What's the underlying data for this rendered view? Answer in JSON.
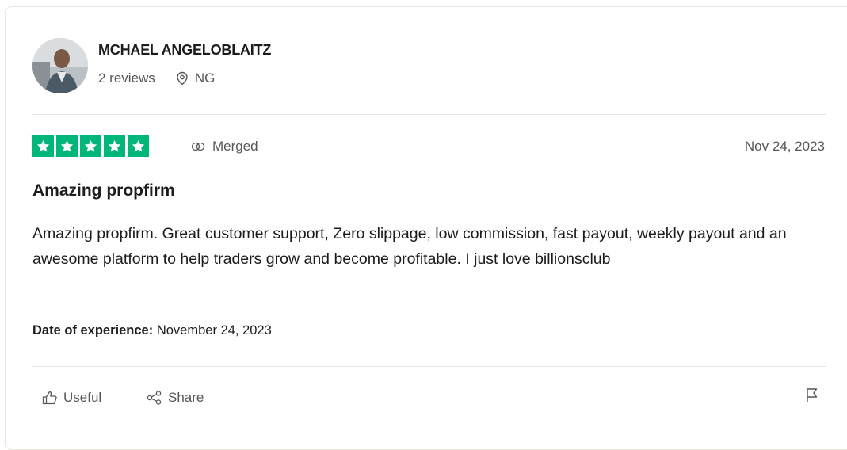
{
  "reviewer": {
    "name": "MCHAEL ANGELOBLAITZ",
    "reviews_count": "2 reviews",
    "country": "NG"
  },
  "review": {
    "rating": 5,
    "max_rating": 5,
    "star_color": "#00b67a",
    "merged_label": "Merged",
    "date": "Nov 24, 2023",
    "title": "Amazing propfirm",
    "body": "Amazing propfirm. Great customer support, Zero slippage, low commission, fast payout, weekly payout and an awesome platform to help traders grow and become profitable. I just love billionsclub",
    "experience_label": "Date of experience:",
    "experience_date": "November 24, 2023"
  },
  "actions": {
    "useful_label": "Useful",
    "share_label": "Share"
  },
  "icons": {
    "location": "location-pin-icon",
    "merged": "merged-icon",
    "useful": "thumbs-up-icon",
    "share": "share-icon",
    "flag": "flag-icon"
  }
}
